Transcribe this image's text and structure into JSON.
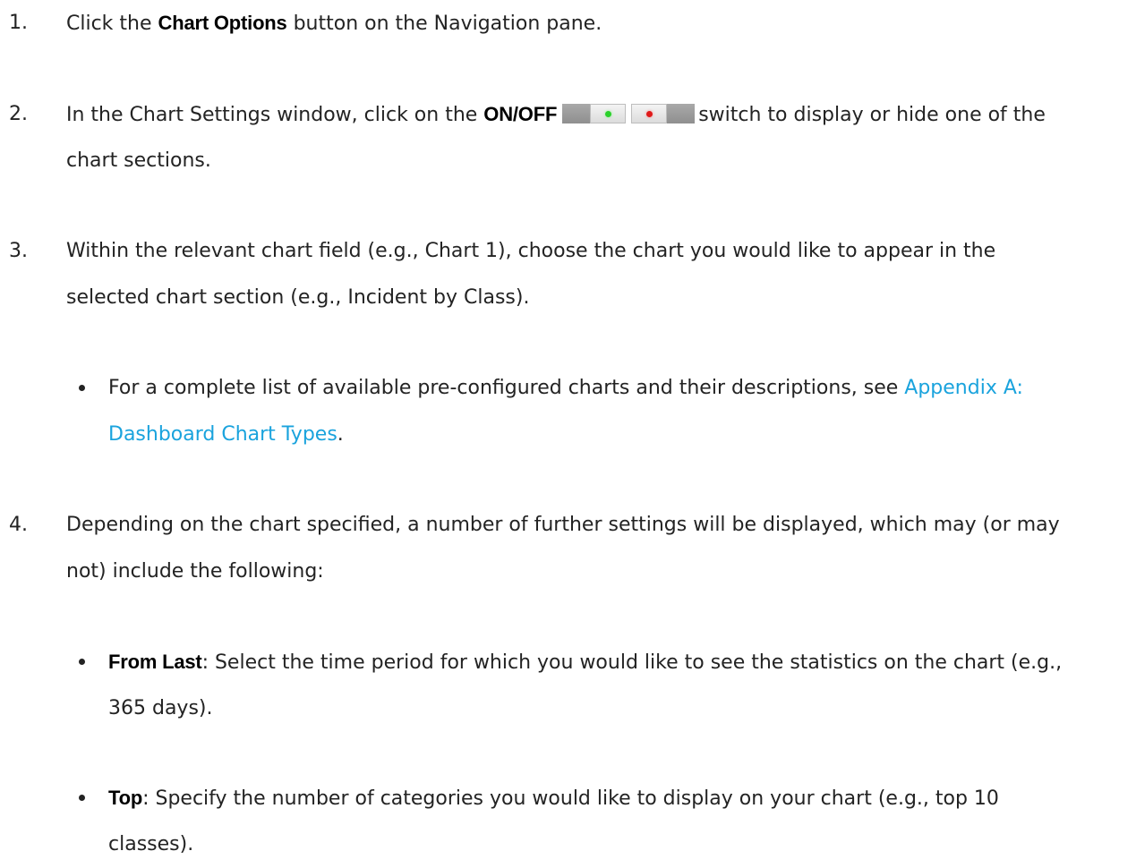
{
  "steps": [
    {
      "number": "1.",
      "line1": {
        "pre": "Click the ",
        "bold": "Chart Options",
        "post": " button on the Navigation pane."
      }
    },
    {
      "number": "2.",
      "line1": {
        "pre": "In the Chart Settings window, click on the ",
        "bold": "ON/OFF",
        "post": "switch to display or hide one of the"
      },
      "line2": "chart sections."
    },
    {
      "number": "3.",
      "line1": "Within the relevant chart field (e.g., Chart 1), choose the chart you would like to appear in the",
      "line2": "selected chart section (e.g., Incident by Class).",
      "bullets": [
        {
          "text": "For a complete list of available pre-configured charts and their descriptions, see ",
          "link_line1": "Appendix A:",
          "link_line2": "Dashboard Chart Types",
          "after": "."
        }
      ]
    },
    {
      "number": "4.",
      "line1": "Depending on the chart specified, a number of further settings will be displayed, which may (or may",
      "line2": "not) include the following:",
      "bullets": [
        {
          "bold": "From Last",
          "text": ": Select the time period for which you would like to see the statistics on the chart (e.g.,",
          "line2": "365 days)."
        },
        {
          "bold": "Top",
          "text": ": Specify the number of categories you would like to display on your chart (e.g., top 10",
          "line2": "classes)."
        }
      ]
    }
  ],
  "switch_icon": {
    "name": "on-off-switch-icon",
    "on_color": "#2bd12b",
    "off_color": "#e01a1a"
  },
  "colors": {
    "text": "#232323",
    "link": "#1aa3dd"
  }
}
